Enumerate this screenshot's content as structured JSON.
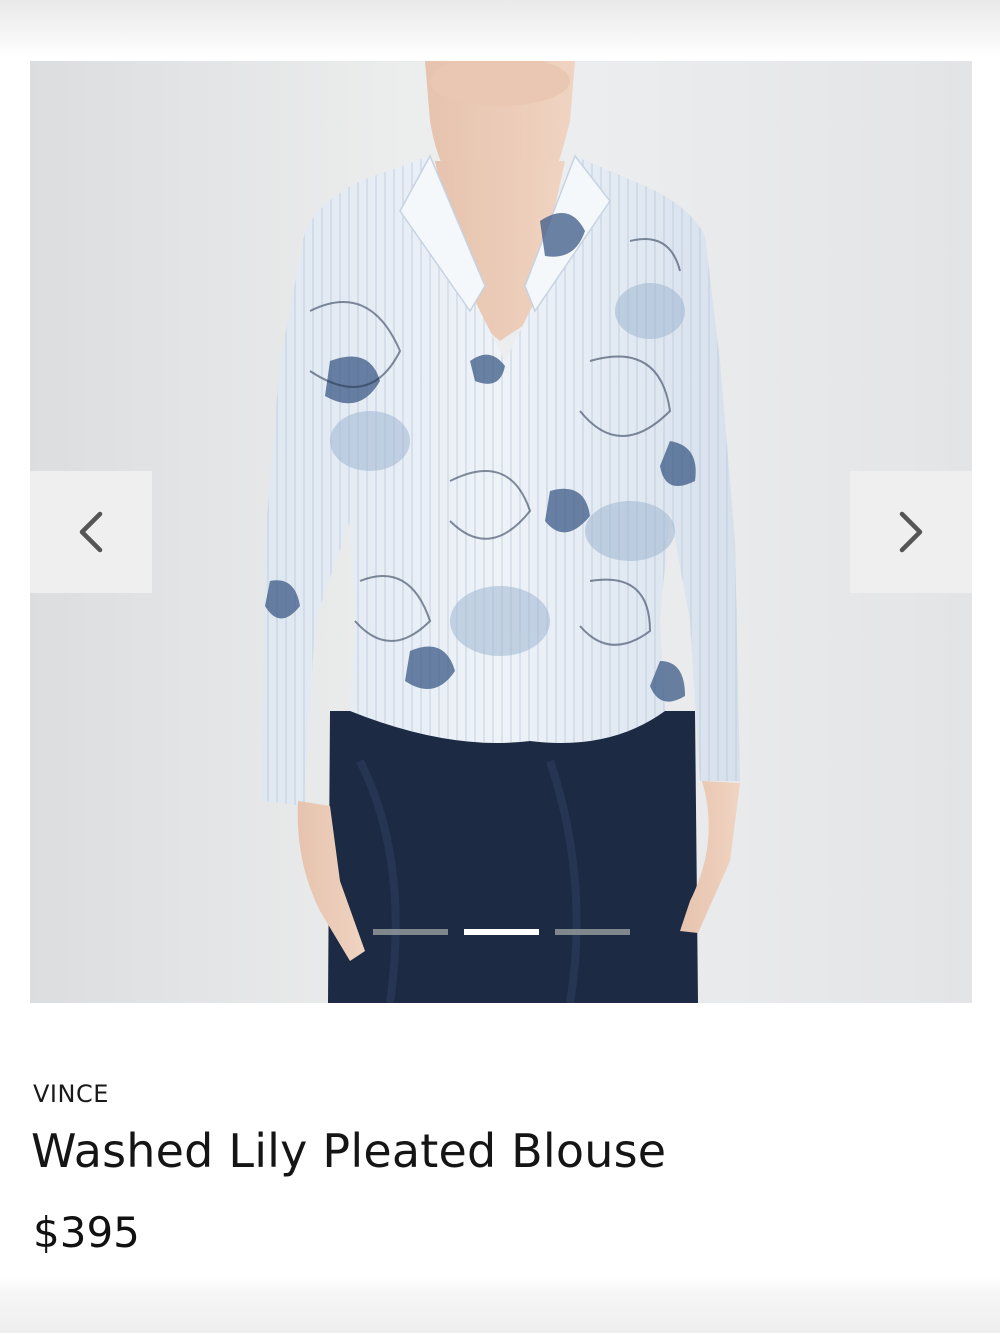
{
  "product": {
    "brand": "VINCE",
    "name": "Washed Lily Pleated Blouse",
    "price": "$395"
  },
  "gallery": {
    "image_description_icon": "product-photo",
    "total_images": 3,
    "active_index": 1,
    "prev_icon": "chevron-left-icon",
    "next_icon": "chevron-right-icon"
  },
  "colors": {
    "background": "#ffffff",
    "text": "#151515",
    "dot_active": "#ffffff",
    "dot_inactive": "#8c9196",
    "skirt": "#1c2a44",
    "blouse_print": "#3b5a85"
  }
}
